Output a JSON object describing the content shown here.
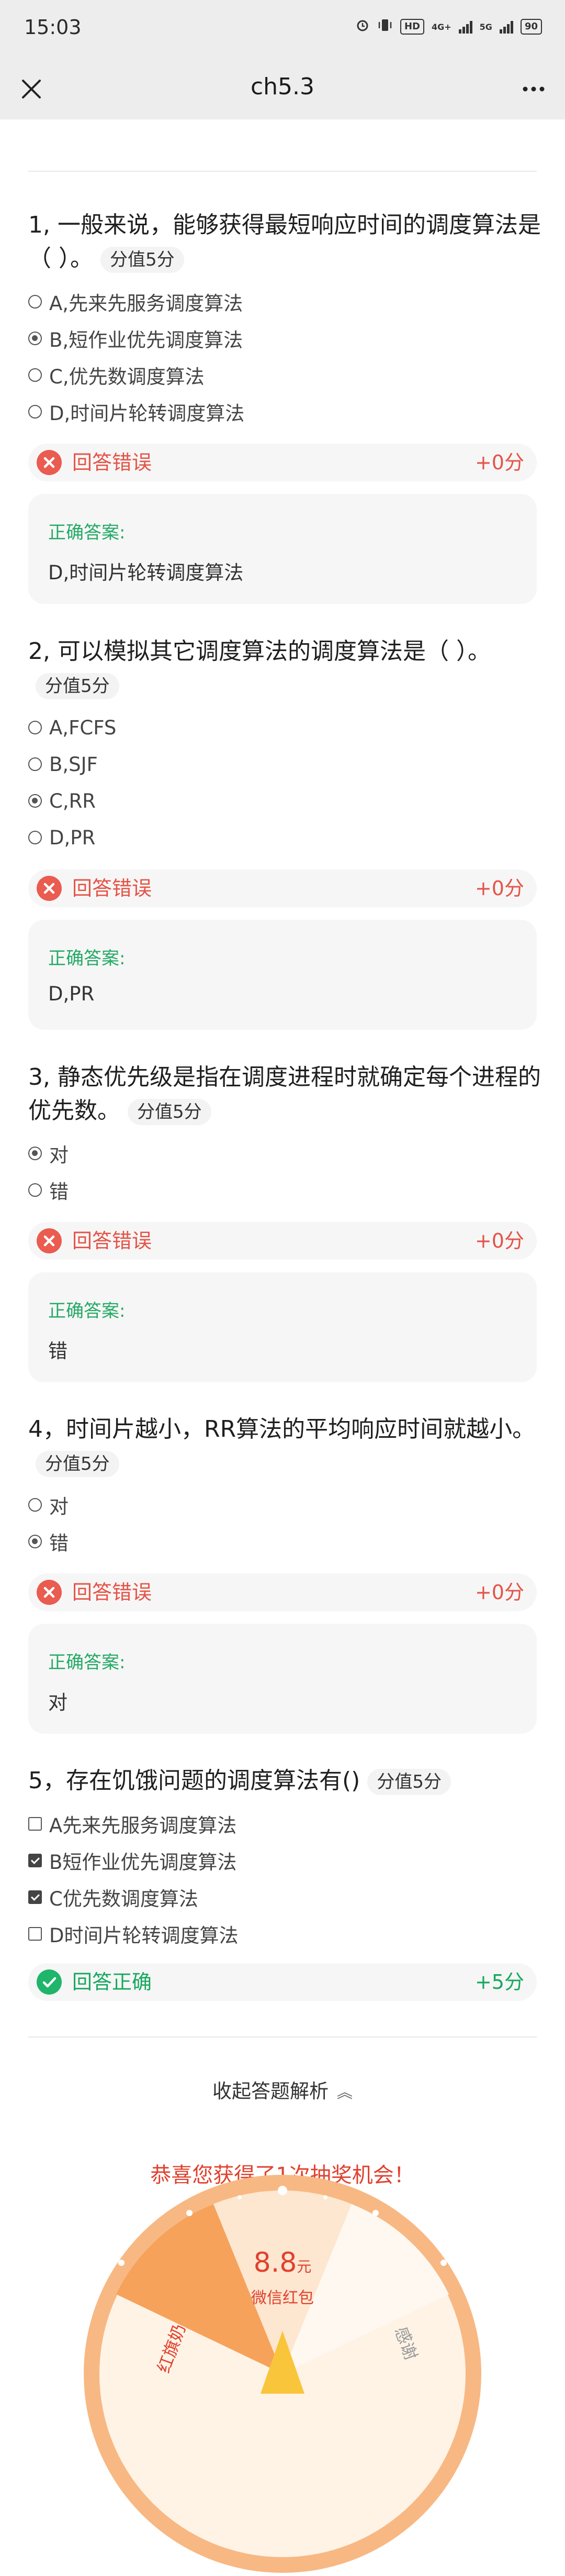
{
  "status_bar": {
    "time": "15:03",
    "hd_label": "HD",
    "net1_label": "4G+",
    "net2_label": "5G",
    "battery": "90"
  },
  "nav": {
    "title": "ch5.3"
  },
  "score_tag": "分值5分",
  "questions": [
    {
      "title": "1, 一般来说，能够获得最短响应时间的调度算法是（ ）。",
      "options": [
        "A,先来先服务调度算法",
        "B,短作业优先调度算法",
        "C,优先数调度算法",
        "D,时间片轮转调度算法"
      ],
      "selected": 1,
      "result": "回答错误",
      "score": "+0分",
      "answer_label": "正确答案:",
      "answer": "D,时间片轮转调度算法"
    },
    {
      "title": "2, 可以模拟其它调度算法的调度算法是（ ）。",
      "options": [
        "A,FCFS",
        "B,SJF",
        "C,RR",
        "D,PR"
      ],
      "selected": 2,
      "result": "回答错误",
      "score": "+0分",
      "answer_label": "正确答案:",
      "answer": "D,PR"
    },
    {
      "title": "3, 静态优先级是指在调度进程时就确定每个进程的优先数。",
      "options": [
        "对",
        "错"
      ],
      "selected": 0,
      "result": "回答错误",
      "score": "+0分",
      "answer_label": "正确答案:",
      "answer": "错"
    },
    {
      "title": "4，时间片越小，RR算法的平均响应时间就越小。",
      "options": [
        "对",
        "错"
      ],
      "selected": 1,
      "result": "回答错误",
      "score": "+0分",
      "answer_label": "正确答案:",
      "answer": "对"
    },
    {
      "title": "5，存在饥饿问题的调度算法有()",
      "options": [
        "A先来先服务调度算法",
        "B短作业优先调度算法",
        "C优先数调度算法",
        "D时间片轮转调度算法"
      ],
      "selected": [
        1,
        2
      ],
      "result": "回答正确",
      "score": "+5分"
    }
  ],
  "collapse_label": "收起答题解析",
  "prize": {
    "title": "恭喜您获得了1次抽奖机会！",
    "amount": "8.8",
    "amount_unit": "元",
    "amount_desc": "微信红包",
    "left_segment": "红旗奶",
    "right_segment": "感谢"
  },
  "colors": {
    "wrong": "#e55347",
    "right": "#16a85e",
    "wheel": "#f6a25b"
  }
}
